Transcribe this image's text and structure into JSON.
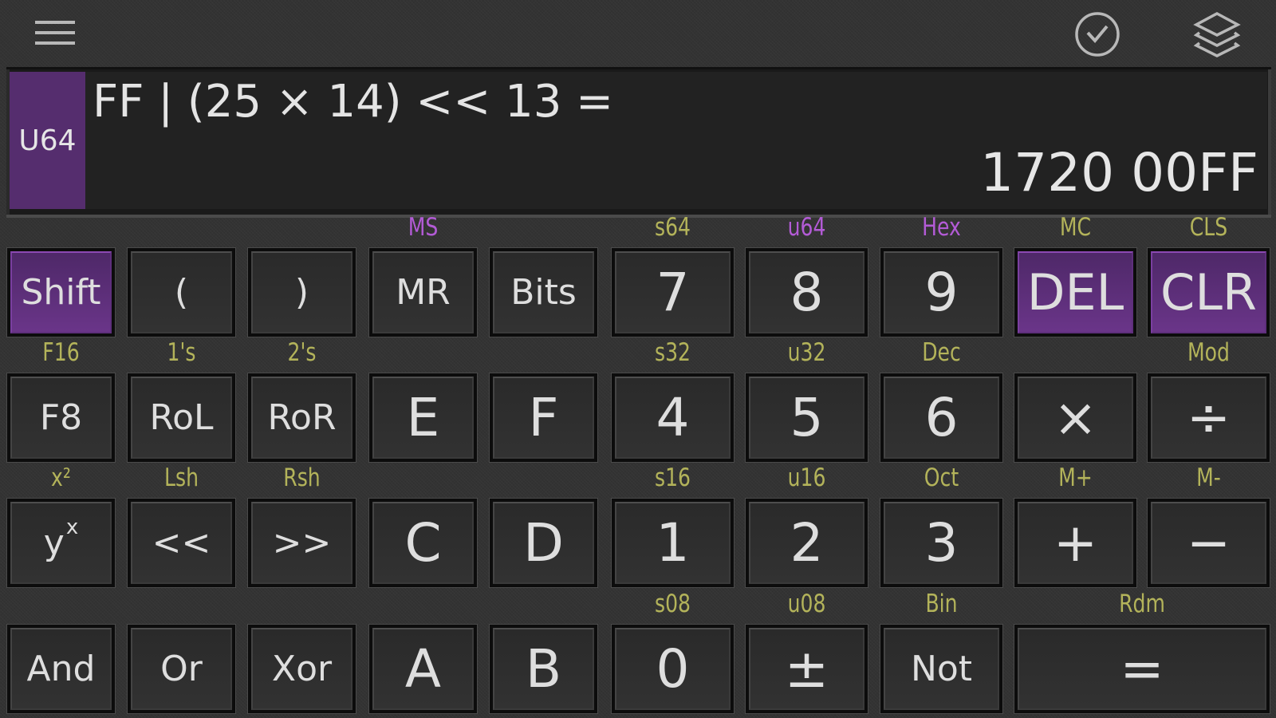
{
  "toolbar": {
    "menu_icon": "hamburger-menu-icon",
    "history_icon": "clock-check-icon",
    "layers_icon": "layers-icon"
  },
  "display": {
    "mode": "U64",
    "expression": "FF | (25 × 14) << 13 =",
    "result": "1720 00FF"
  },
  "colors": {
    "accent_purple": "#6a3589",
    "mode_badge": "#552d6e",
    "shift_label_yellow": "#b3b35a",
    "shift_label_purple": "#b35bd6",
    "display_bg": "#222222"
  },
  "keys": {
    "row1": [
      {
        "label": "Shift",
        "shift": "",
        "style": "purple"
      },
      {
        "label": "(",
        "shift": ""
      },
      {
        "label": ")",
        "shift": ""
      },
      {
        "label": "MR",
        "shift": "MS",
        "shift_color": "purple"
      },
      {
        "label": "Bits",
        "shift": ""
      },
      {
        "label": "7",
        "shift": "s64"
      },
      {
        "label": "8",
        "shift": "u64",
        "shift_color": "purple"
      },
      {
        "label": "9",
        "shift": "Hex",
        "shift_color": "purple"
      },
      {
        "label": "DEL",
        "shift": "MC",
        "style": "purple"
      },
      {
        "label": "CLR",
        "shift": "CLS",
        "style": "purple"
      }
    ],
    "row2": [
      {
        "label": "F8",
        "shift": "F16"
      },
      {
        "label": "RoL",
        "shift": "1's"
      },
      {
        "label": "RoR",
        "shift": "2's"
      },
      {
        "label": "E",
        "shift": ""
      },
      {
        "label": "F",
        "shift": ""
      },
      {
        "label": "4",
        "shift": "s32"
      },
      {
        "label": "5",
        "shift": "u32"
      },
      {
        "label": "6",
        "shift": "Dec"
      },
      {
        "label": "×",
        "shift": ""
      },
      {
        "label": "÷",
        "shift": "Mod"
      }
    ],
    "row3": [
      {
        "label": "y",
        "sup": "x",
        "shift": "x²"
      },
      {
        "label": "<<",
        "shift": "Lsh"
      },
      {
        "label": ">>",
        "shift": "Rsh"
      },
      {
        "label": "C",
        "shift": ""
      },
      {
        "label": "D",
        "shift": ""
      },
      {
        "label": "1",
        "shift": "s16"
      },
      {
        "label": "2",
        "shift": "u16"
      },
      {
        "label": "3",
        "shift": "Oct"
      },
      {
        "label": "+",
        "shift": "M+"
      },
      {
        "label": "−",
        "shift": "M-"
      }
    ],
    "row4": [
      {
        "label": "And",
        "shift": ""
      },
      {
        "label": "Or",
        "shift": ""
      },
      {
        "label": "Xor",
        "shift": ""
      },
      {
        "label": "A",
        "shift": ""
      },
      {
        "label": "B",
        "shift": ""
      },
      {
        "label": "0",
        "shift": "s08"
      },
      {
        "label": "±",
        "shift": "u08"
      },
      {
        "label": "Not",
        "shift": "Bin"
      },
      {
        "label": "=",
        "shift": "Rdm"
      }
    ]
  }
}
